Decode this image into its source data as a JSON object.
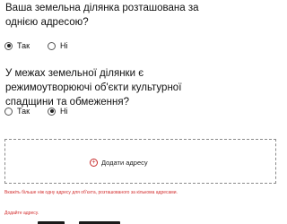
{
  "question1": {
    "text": "Ваша земельна ділянка розташована за однією адресою?",
    "options": [
      {
        "label": "Так",
        "selected": true
      },
      {
        "label": "Ні",
        "selected": false
      }
    ]
  },
  "question2": {
    "text": "У межах земельної ділянки є режимоутворюючі об'єкти культурної спадщини та обмеження?",
    "options": [
      {
        "label": "Так",
        "selected": false
      },
      {
        "label": "Ні",
        "selected": true
      }
    ]
  },
  "address": {
    "add_label": "Додати адресу",
    "add_icon": "plus-circle-icon",
    "error_multiple": "Вкажіть більше ніж одну адресу для об'єкта, розташованого за кількома адресами.",
    "error_required": "Додайте адресу."
  },
  "colors": {
    "accent": "#c62828",
    "error": "#d32f2f"
  }
}
